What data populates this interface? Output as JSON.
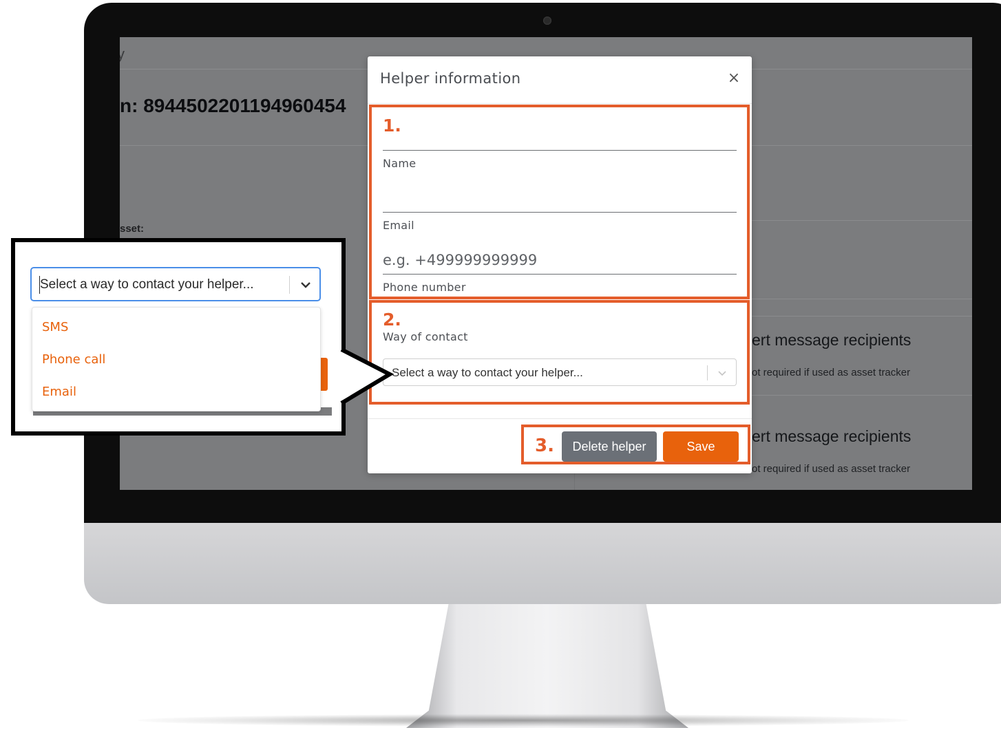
{
  "background_app": {
    "header_fragment": "y",
    "serial_label": "n: 89445022011949604​54",
    "asset_label": "sset:",
    "cards": [
      {
        "title": "ert message recipients",
        "subtitle": "ot required if used as asset tracker"
      },
      {
        "title": "ert message recipients",
        "subtitle": "ot required if used as asset tracker"
      }
    ]
  },
  "modal": {
    "title": "Helper information",
    "close_symbol": "×",
    "steps": {
      "one": "1.",
      "two": "2.",
      "three": "3."
    },
    "fields": {
      "name_label": "Name",
      "email_label": "Email",
      "phone_placeholder": "e.g. +499999999999",
      "phone_label": "Phone number",
      "way_label": "Way of contact",
      "way_placeholder": "Select a way to contact your helper..."
    },
    "buttons": {
      "delete": "Delete helper",
      "save": "Save"
    }
  },
  "callout": {
    "select_placeholder": "Select a way to contact your helper...",
    "options": [
      "SMS",
      "Phone call",
      "Email"
    ]
  },
  "colors": {
    "accent_orange": "#e8620c",
    "highlight_orange": "#e45d2b",
    "focus_blue": "#4a8ee8",
    "delete_gray": "#6b7077"
  }
}
